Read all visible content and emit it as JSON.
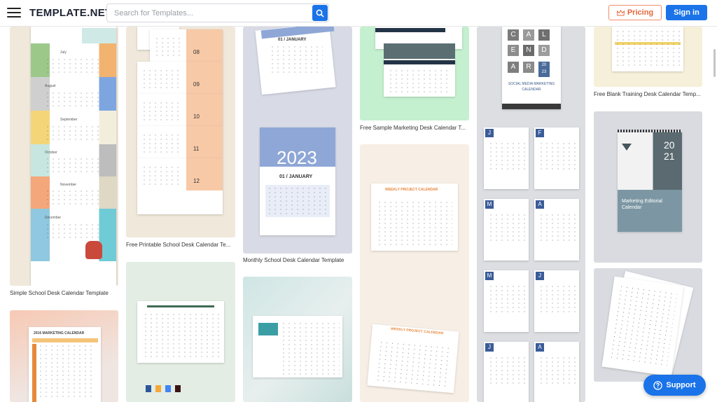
{
  "header": {
    "logo": "TEMPLATE.NET",
    "search_placeholder": "Search for Templates...",
    "pricing_label": "Pricing",
    "signin_label": "Sign in"
  },
  "cards": {
    "simple_school": {
      "caption": "Simple School Desk Calendar Template",
      "months": [
        "July",
        "August",
        "September",
        "October",
        "November",
        "December"
      ]
    },
    "printable_school": {
      "caption": "Free Printable School Desk Calendar Te...",
      "numbers": [
        "08",
        "09",
        "10",
        "11",
        "12"
      ]
    },
    "monthly_school": {
      "caption": "Monthly School Desk Calendar Template",
      "year": "2023",
      "heading": "01 / JANUARY",
      "top_heading": "01 / JANUARY"
    },
    "sample_marketing": {
      "caption": "Free Sample Marketing Desk Calendar T..."
    },
    "social_media": {
      "letters": [
        "C",
        "A",
        "L",
        "E",
        "N",
        "D",
        "A",
        "R",
        "20",
        "23"
      ],
      "title": "SOCIAL MEDIA MARKETING CALENDAR"
    },
    "blank_training": {
      "caption": "Free Blank Training Desk Calendar Temp..."
    },
    "marketing_editorial": {
      "year_top": "20",
      "year_bottom": "21",
      "title": "Marketing Editorial Calendar"
    },
    "weekly_project": {
      "title_top": "WEEKLY PROJECT CALENDAR",
      "title_bottom": "WEEKLY PROJECT CALENDAR"
    },
    "marketing_2016": {
      "title": "2016 MARKETING CALENDAR"
    },
    "monthly_letters": {
      "letters": [
        "J",
        "F",
        "M",
        "A",
        "M",
        "J",
        "J",
        "A"
      ]
    }
  },
  "support": {
    "label": "Support"
  },
  "colors": {
    "accent": "#1a73e8",
    "pricing": "#e7643a"
  }
}
